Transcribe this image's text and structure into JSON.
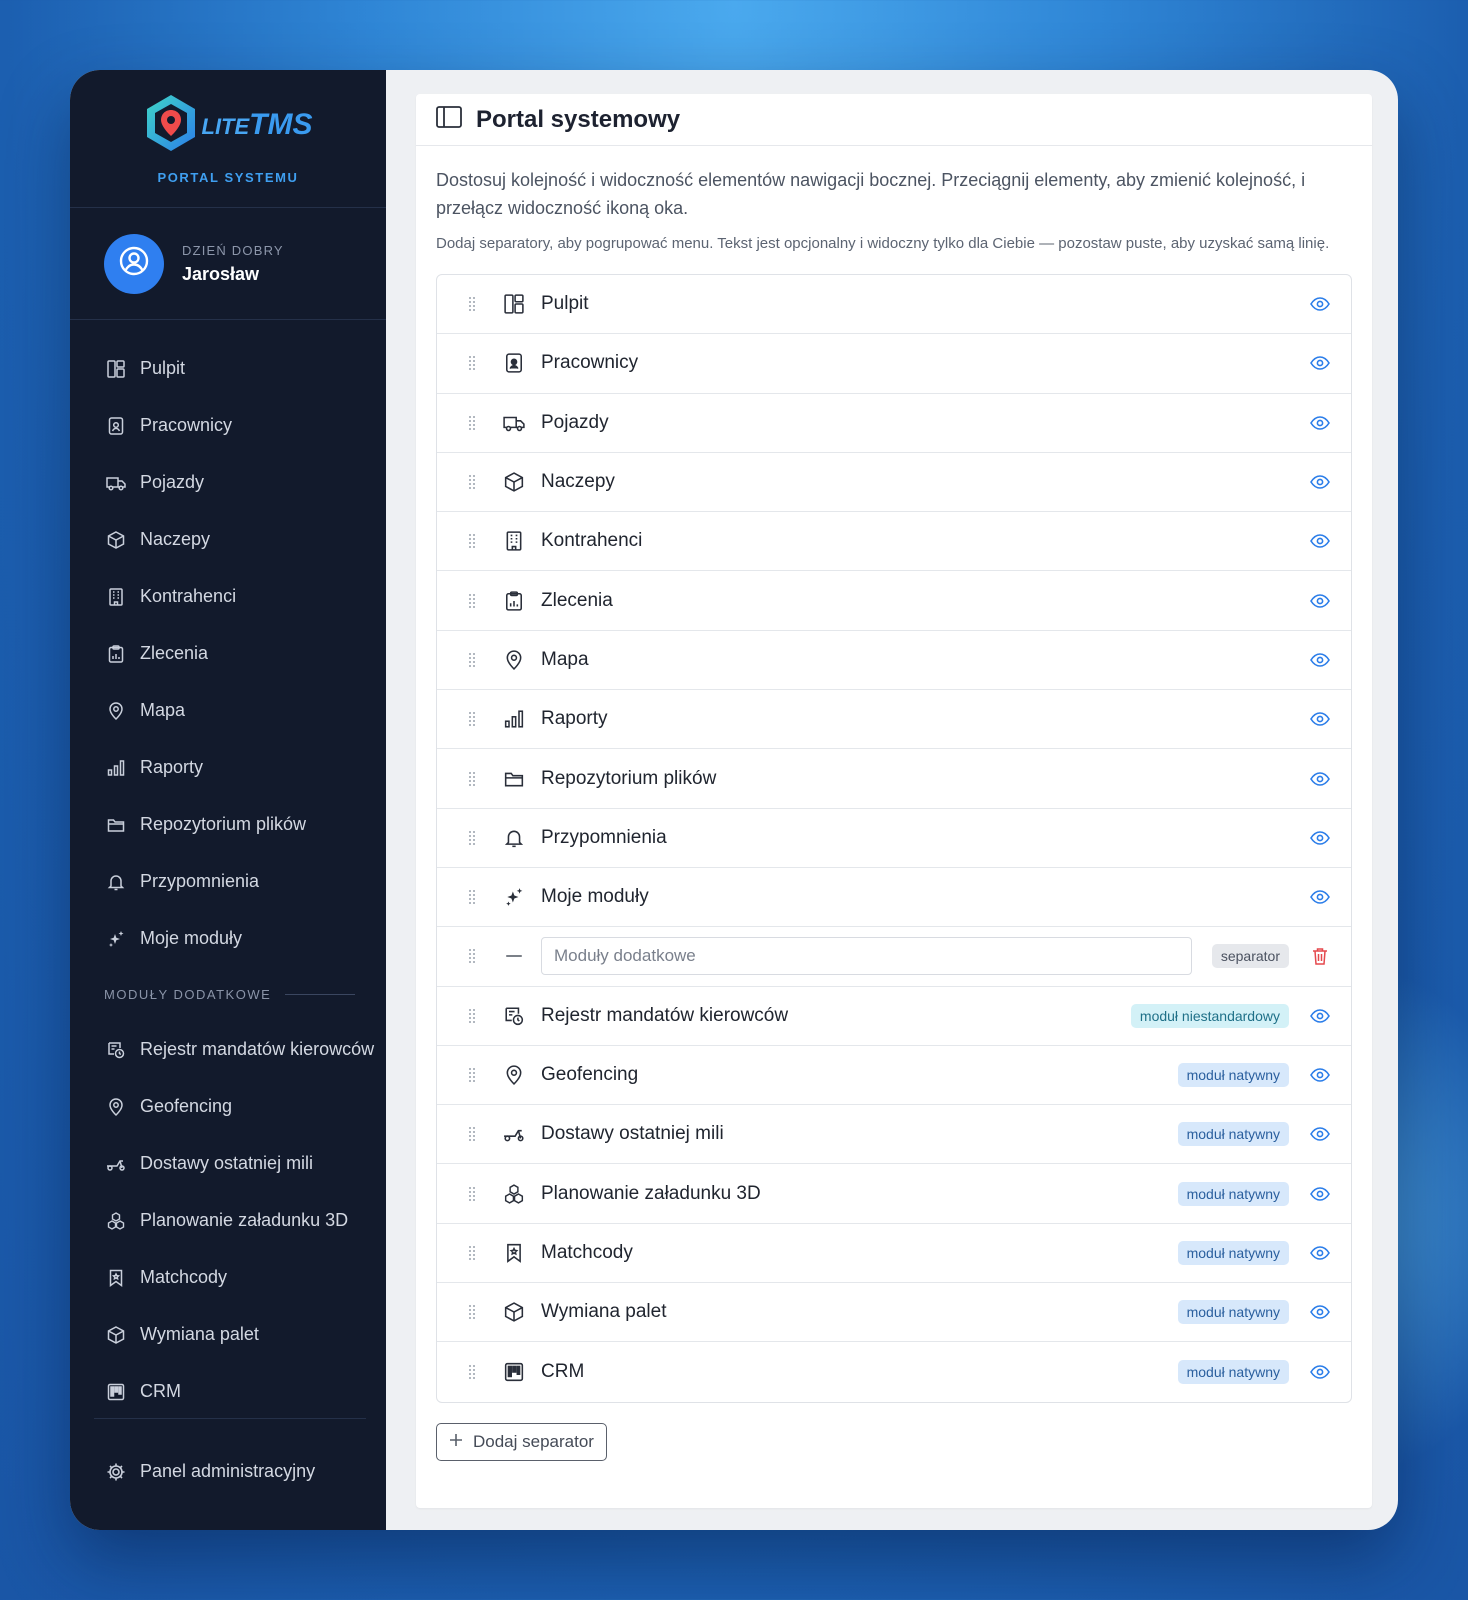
{
  "brand": {
    "logo_prefix": "LITE",
    "logo_name": "TMS",
    "subtitle": "PORTAL SYSTEMU"
  },
  "user": {
    "greeting": "DZIEŃ DOBRY",
    "name": "Jarosław"
  },
  "sidebar": {
    "items": [
      {
        "label": "Pulpit",
        "icon": "dashboard-icon"
      },
      {
        "label": "Pracownicy",
        "icon": "employee-badge-icon"
      },
      {
        "label": "Pojazdy",
        "icon": "truck-icon"
      },
      {
        "label": "Naczepy",
        "icon": "box-icon"
      },
      {
        "label": "Kontrahenci",
        "icon": "building-icon"
      },
      {
        "label": "Zlecenia",
        "icon": "clipboard-chart-icon"
      },
      {
        "label": "Mapa",
        "icon": "map-pin-icon"
      },
      {
        "label": "Raporty",
        "icon": "bar-chart-icon"
      },
      {
        "label": "Repozytorium plików",
        "icon": "folder-icon"
      },
      {
        "label": "Przypomnienia",
        "icon": "bell-icon"
      },
      {
        "label": "Moje moduły",
        "icon": "sparkles-icon"
      }
    ],
    "section_label": "MODUŁY DODATKOWE",
    "extra_items": [
      {
        "label": "Rejestr mandatów kierowców",
        "icon": "ticket-clock-icon"
      },
      {
        "label": "Geofencing",
        "icon": "map-pin-icon"
      },
      {
        "label": "Dostawy ostatniej mili",
        "icon": "scooter-icon"
      },
      {
        "label": "Planowanie załadunku 3D",
        "icon": "boxes-icon"
      },
      {
        "label": "Matchcody",
        "icon": "bookmark-icon"
      },
      {
        "label": "Wymiana palet",
        "icon": "box-icon"
      },
      {
        "label": "CRM",
        "icon": "kanban-icon"
      }
    ],
    "footer_label": "Panel administracyjny"
  },
  "page": {
    "title": "Portal systemowy",
    "description": "Dostosuj kolejność i widoczność elementów nawigacji bocznej. Przeciągnij elementy, aby zmienić kolejność, i przełącz widoczność ikoną oka.",
    "hint": "Dodaj separatory, aby pogrupować menu. Tekst jest opcjonalny i widoczny tylko dla Ciebie — pozostaw puste, aby uzyskać samą linię.",
    "add_separator_label": "Dodaj separator"
  },
  "rows": [
    {
      "label": "Pulpit",
      "icon": "dashboard-icon"
    },
    {
      "label": "Pracownicy",
      "icon": "employee-badge-icon"
    },
    {
      "label": "Pojazdy",
      "icon": "truck-icon"
    },
    {
      "label": "Naczepy",
      "icon": "box-icon"
    },
    {
      "label": "Kontrahenci",
      "icon": "building-icon"
    },
    {
      "label": "Zlecenia",
      "icon": "clipboard-chart-icon"
    },
    {
      "label": "Mapa",
      "icon": "map-pin-icon"
    },
    {
      "label": "Raporty",
      "icon": "bar-chart-icon"
    },
    {
      "label": "Repozytorium plików",
      "icon": "folder-icon"
    },
    {
      "label": "Przypomnienia",
      "icon": "bell-icon"
    },
    {
      "label": "Moje moduły",
      "icon": "sparkles-icon"
    },
    {
      "type": "separator",
      "placeholder": "Moduły dodatkowe",
      "value": "",
      "badge": "separator",
      "icon": "minus-icon"
    },
    {
      "label": "Rejestr mandatów kierowców",
      "icon": "ticket-clock-icon",
      "badge": "moduł niestandardowy",
      "badge_kind": "custom"
    },
    {
      "label": "Geofencing",
      "icon": "map-pin-icon",
      "badge": "moduł natywny",
      "badge_kind": "native"
    },
    {
      "label": "Dostawy ostatniej mili",
      "icon": "scooter-icon",
      "badge": "moduł natywny",
      "badge_kind": "native"
    },
    {
      "label": "Planowanie załadunku 3D",
      "icon": "boxes-icon",
      "badge": "moduł natywny",
      "badge_kind": "native"
    },
    {
      "label": "Matchcody",
      "icon": "bookmark-icon",
      "badge": "moduł natywny",
      "badge_kind": "native"
    },
    {
      "label": "Wymiana palet",
      "icon": "box-icon",
      "badge": "moduł natywny",
      "badge_kind": "native"
    },
    {
      "label": "CRM",
      "icon": "kanban-icon",
      "badge": "moduł natywny",
      "badge_kind": "native"
    }
  ],
  "colors": {
    "accent": "#2f7ff0",
    "sidebar_bg": "#121a2c",
    "eye": "#2b7de9",
    "trash": "#e5484d"
  }
}
